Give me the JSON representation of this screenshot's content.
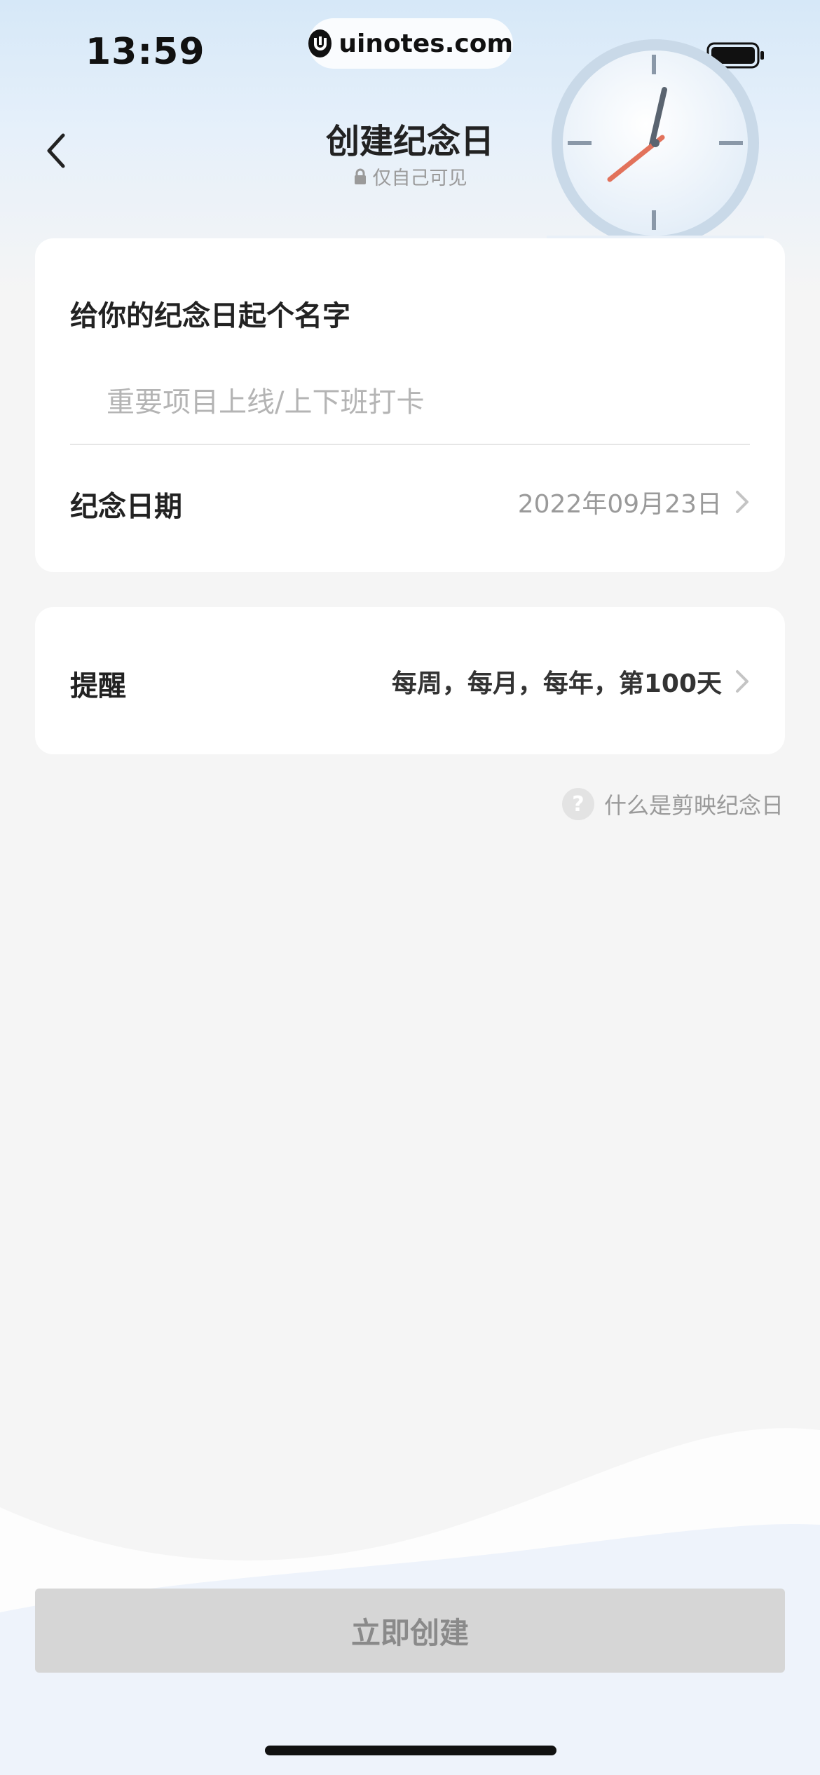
{
  "status_bar": {
    "time": "13:59",
    "url": "uinotes.com",
    "icons": [
      "wifi-icon",
      "battery-icon"
    ]
  },
  "nav": {
    "back_icon": "chevron-left-icon",
    "title": "创建纪念日",
    "subtitle": "仅自己可见",
    "subtitle_icon": "lock-icon",
    "decoration": "clock-illustration"
  },
  "name_card": {
    "label": "给你的纪念日起个名字",
    "input_value": "",
    "input_placeholder": "重要项目上线/上下班打卡",
    "date_label": "纪念日期",
    "date_value": "2022年09月23日"
  },
  "remind_card": {
    "label": "提醒",
    "value": "每周，每月，每年，第100天"
  },
  "help": {
    "icon": "question-icon",
    "text": "什么是剪映纪念日"
  },
  "footer": {
    "create_label": "立即创建"
  },
  "colors": {
    "page_bg": "#f5f5f5",
    "header_gradient_top": "#d6e8f8",
    "card_bg": "#ffffff",
    "button_disabled_bg": "#d6d6d6",
    "muted_text": "#9a9a9a",
    "clock_hand_accent": "#e2725b"
  }
}
